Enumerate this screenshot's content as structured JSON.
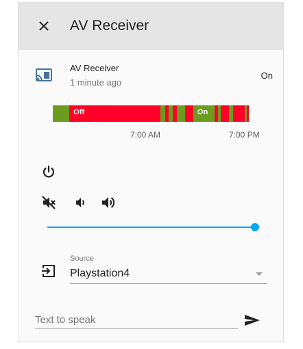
{
  "dialog": {
    "title": "AV Receiver",
    "close_icon": "close-icon"
  },
  "entity": {
    "icon": "cast-icon",
    "name": "AV Receiver",
    "last_changed": "1 minute ago",
    "state": "On"
  },
  "history": {
    "segments": [
      {
        "state": "on",
        "label": "",
        "start": 0.0,
        "end": 0.085
      },
      {
        "state": "off",
        "label": "Off",
        "start": 0.085,
        "end": 0.55
      },
      {
        "state": "on",
        "label": "",
        "start": 0.55,
        "end": 0.575
      },
      {
        "state": "off",
        "label": "",
        "start": 0.575,
        "end": 0.592
      },
      {
        "state": "on",
        "label": "",
        "start": 0.592,
        "end": 0.612
      },
      {
        "state": "off",
        "label": "",
        "start": 0.612,
        "end": 0.632
      },
      {
        "state": "on",
        "label": "",
        "start": 0.632,
        "end": 0.675
      },
      {
        "state": "off",
        "label": "",
        "start": 0.675,
        "end": 0.717
      },
      {
        "state": "on",
        "label": "On",
        "start": 0.717,
        "end": 0.824
      },
      {
        "state": "off",
        "label": "",
        "start": 0.824,
        "end": 0.843
      },
      {
        "state": "on",
        "label": "",
        "start": 0.843,
        "end": 0.855
      },
      {
        "state": "off",
        "label": "",
        "start": 0.855,
        "end": 0.898
      },
      {
        "state": "on",
        "label": "",
        "start": 0.898,
        "end": 0.92
      },
      {
        "state": "off",
        "label": "",
        "start": 0.92,
        "end": 0.98
      },
      {
        "state": "on",
        "label": "",
        "start": 0.98,
        "end": 0.99
      },
      {
        "state": "off",
        "label": "",
        "start": 0.99,
        "end": 1.0
      }
    ],
    "ticks": [
      "7:00 AM",
      "7:00 PM"
    ],
    "colors": {
      "on": "#6b9b1f",
      "off": "#ff0029"
    }
  },
  "controls": {
    "power_icon": "power-icon",
    "mute_icon": "volume-off-icon",
    "volume_down_icon": "volume-down-icon",
    "volume_up_icon": "volume-up-icon",
    "volume_level": 1.0,
    "accent": "#03a9f4"
  },
  "source": {
    "icon": "login-variant-icon",
    "label": "Source",
    "value": "Playstation4"
  },
  "tts": {
    "placeholder": "Text to speak",
    "value": "",
    "send_icon": "send-icon"
  }
}
